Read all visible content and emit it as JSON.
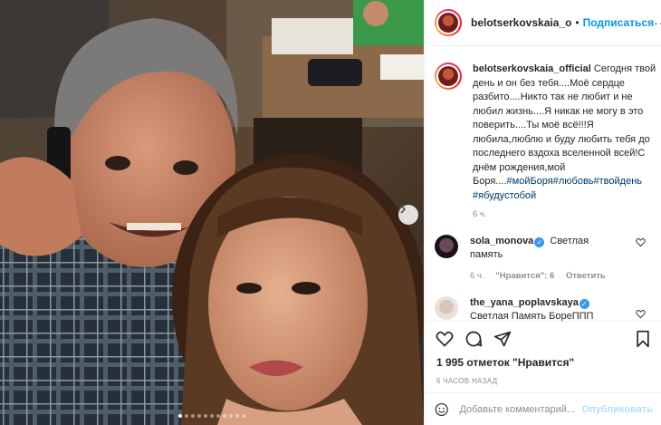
{
  "post": {
    "author": "belotserkovskaia_o",
    "follow_label": "Подписаться",
    "separator": "•",
    "more": "···",
    "caption": {
      "username": "belotserkovskaia_official",
      "text": "Сегодня твой день и он без тебя....Моё сердце разбито....Никто так не любит и не любил жизнь....Я никак не могу в это поверить....Ты моё всё!!!Я любила,люблю и буду любить тебя до последнего вздоха вселенной всей!С днём рождения,мой Боря....",
      "hashtags": [
        "#мойБоря",
        "#любовь",
        "#твойдень",
        "#ябудустобой"
      ],
      "time": "6 ч."
    },
    "comments": [
      {
        "username": "sola_monova",
        "verified": true,
        "text": "Светлая память",
        "time": "6 ч.",
        "likes": "\"Нравится\": 6",
        "reply": "Ответить"
      },
      {
        "username": "the_yana_poplavskaya",
        "verified": true,
        "text": "Светлая Память БореППП"
      }
    ],
    "likes_count": "1 995 отметок \"Нравится\"",
    "posted": "6 ЧАСОВ НАЗАД",
    "comment_placeholder": "Добавьте комментарий...",
    "publish_label": "Опубликовать",
    "carousel": {
      "count": 11,
      "active_index": 0
    }
  },
  "colors": {
    "link": "#0095f6",
    "hashtag": "#00376b",
    "verified": "#3897f0",
    "muted": "#8e8e8e",
    "publish_disabled": "#b2dffc"
  },
  "icons": {
    "like": "heart-icon",
    "comment": "comment-bubble-icon",
    "share": "paper-plane-icon",
    "save": "bookmark-icon",
    "emoji": "smiley-icon",
    "next": "chevron-right-icon"
  }
}
